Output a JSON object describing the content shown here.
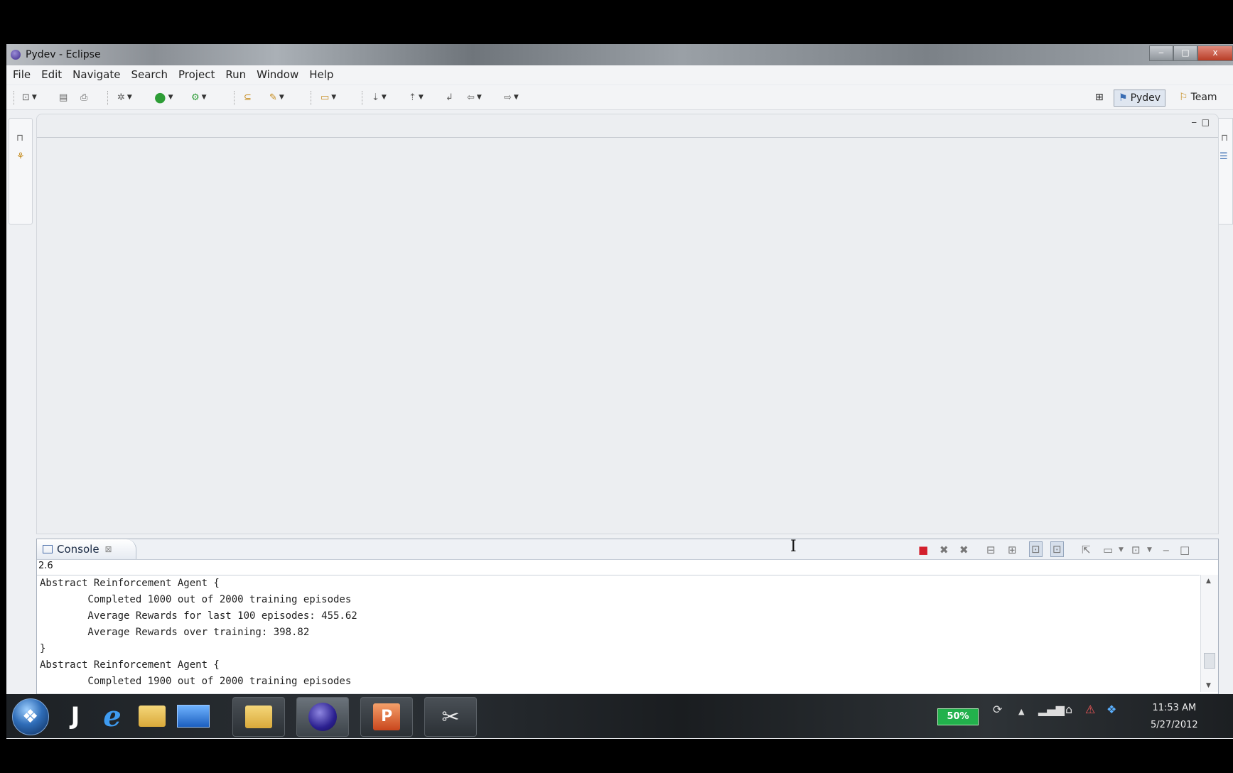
{
  "window": {
    "title": "Pydev - Eclipse",
    "controls": {
      "minimize": "‒",
      "maximize": "□",
      "close": "x"
    }
  },
  "menubar": {
    "items": [
      "File",
      "Edit",
      "Navigate",
      "Search",
      "Project",
      "Run",
      "Window",
      "Help"
    ]
  },
  "perspectives": {
    "open_icon": "open-perspective-icon",
    "items": [
      {
        "label": "Pydev",
        "active": true
      },
      {
        "label": "Team",
        "active": false
      }
    ]
  },
  "console": {
    "tab_label": "Console",
    "tab_close": "⊠",
    "python_version": "2.6",
    "lines": [
      "Abstract Reinforcement Agent {",
      "        Completed 1000 out of 2000 training episodes",
      "        Average Rewards for last 100 episodes: 455.62",
      "        Average Rewards over training: 398.82",
      "}",
      "Abstract Reinforcement Agent {",
      "        Completed 1900 out of 2000 training episodes"
    ]
  },
  "taskbar": {
    "battery_percent": "50%",
    "time": "11:53 AM",
    "date": "5/27/2012",
    "apps": [
      "windows-start",
      "jetbrains",
      "internet-explorer",
      "file-explorer",
      "desktop",
      "file-manager",
      "eclipse",
      "powerpoint",
      "snipping-tool"
    ]
  },
  "colors": {
    "accent": "#4a6ea9",
    "terminate": "#d31f2c",
    "battery": "#22b14c"
  }
}
